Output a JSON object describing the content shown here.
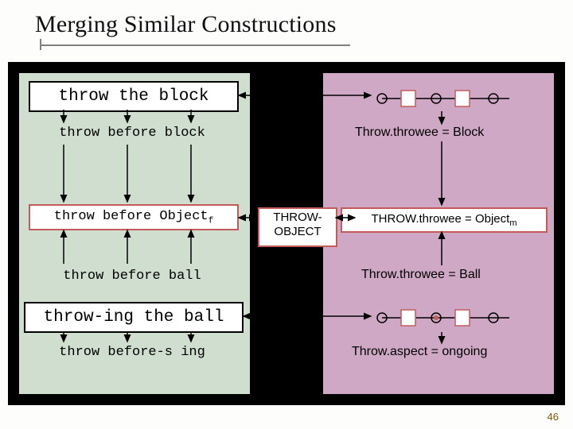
{
  "title": "Merging Similar Constructions",
  "left": {
    "row1": "throw the block",
    "row2a": "throw before block",
    "row3_pre": "throw before Object",
    "row3_sub": "f",
    "row4": "throw before ball",
    "row5": "throw-ing the ball",
    "row6": "throw before-s ing"
  },
  "center": {
    "line1": "THROW-",
    "line2": "OBJECT"
  },
  "right": {
    "row2": "Throw.throwee = Block",
    "row3_pre": "THROW.throwee = Object",
    "row3_sub": "m",
    "row4": "Throw.throwee = Ball",
    "row6": "Throw.aspect = ongoing"
  },
  "pagenum": "46"
}
